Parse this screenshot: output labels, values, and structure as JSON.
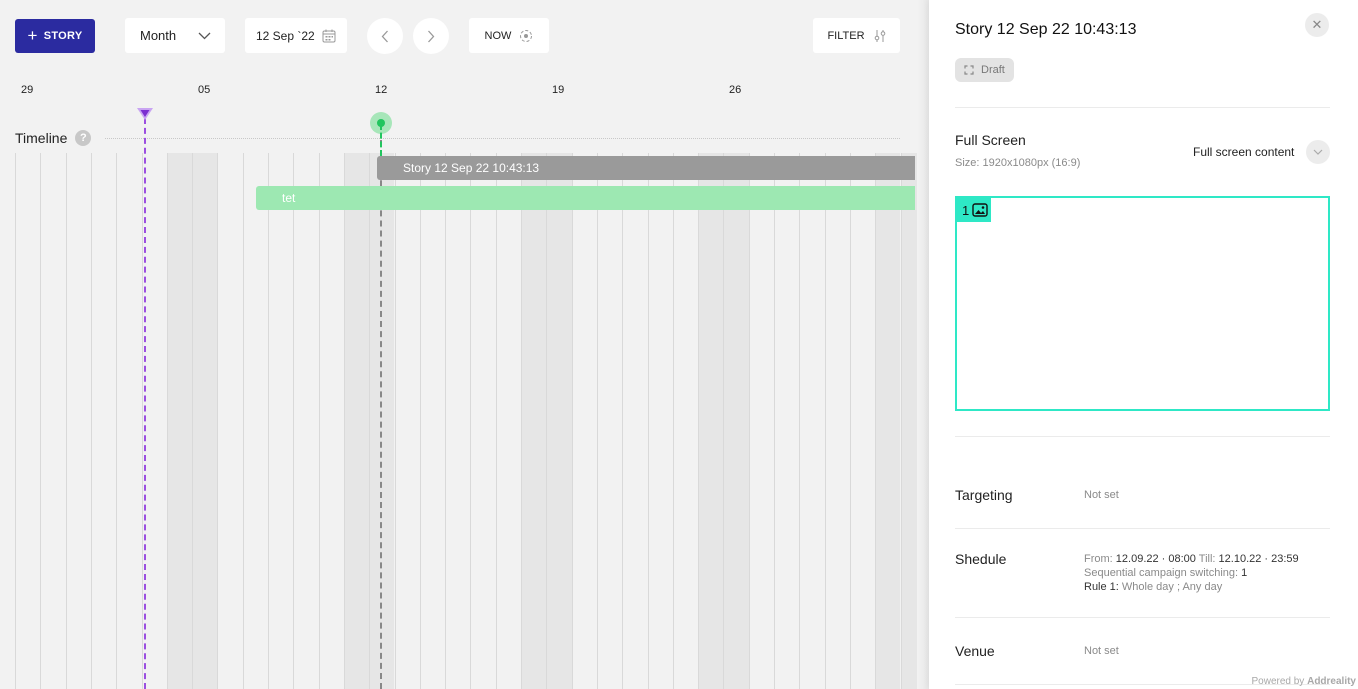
{
  "toolbar": {
    "story_label": "STORY",
    "view_mode": "Month",
    "date": "12 Sep `22",
    "now_label": "NOW",
    "filter_label": "FILTER"
  },
  "timeline": {
    "label": "Timeline",
    "week_labels": [
      "29",
      "05",
      "12",
      "19",
      "26"
    ],
    "bars": {
      "story": "Story 12 Sep 22 10:43:13",
      "tet": "tet"
    }
  },
  "colors": {
    "primary": "#2b2ba0",
    "marker": "#9b4fe0",
    "now": "#22c55e",
    "story_bar": "#9a9a9a",
    "tet_bar": "#9de8b2",
    "zone": "#2ee8c6"
  },
  "panel": {
    "title": "Story 12 Sep 22 10:43:13",
    "status": "Draft",
    "full_screen": {
      "title": "Full Screen",
      "size": "Size: 1920x1080px (16:9)",
      "content_select": "Full screen content",
      "zone_number": "1"
    },
    "targeting": {
      "label": "Targeting",
      "value": "Not set"
    },
    "schedule": {
      "label": "Shedule",
      "from_label": "From:",
      "from_value": "12.09.22 · 08:00",
      "till_label": "Till:",
      "till_value": "12.10.22 · 23:59",
      "switching_label": "Sequential campaign switching:",
      "switching_value": "1",
      "rule_label": "Rule 1:",
      "rule_value": "Whole day ;   Any day"
    },
    "venue": {
      "label": "Venue",
      "value": "Not set"
    },
    "powered_label": "Powered by",
    "powered_brand": "Addreality"
  }
}
